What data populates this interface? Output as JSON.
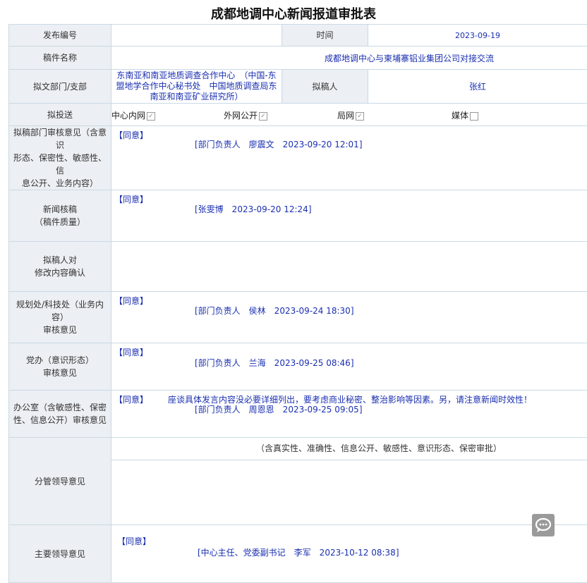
{
  "title": "成都地调中心新闻报道审批表",
  "labels": {
    "number": "发布编号",
    "time": "时间",
    "manuscript_name": "稿件名称",
    "department": "拟文部门/支部",
    "drafter": "拟稿人",
    "send_to": "拟投送",
    "dept_review_l1": "拟稿部门审核意见（含意识",
    "dept_review_l2": "形态、保密性、敏感性、信",
    "dept_review_l3": "息公开、业务内容）",
    "news_check_l1": "新闻核稿",
    "news_check_l2": "（稿件质量）",
    "drafter_confirm_l1": "拟稿人对",
    "drafter_confirm_l2": "修改内容确认",
    "planning_l1": "规划处/科技处（业务内",
    "planning_l2": "容）",
    "planning_l3": "审核意见",
    "party_l1": "党办（意识形态）",
    "party_l2": "审核意见",
    "office_l1": "办公室（含敏感性、保密",
    "office_l2": "性、信息公开）审核意见",
    "branch_leader": "分管领导意见",
    "main_leader": "主要领导意见"
  },
  "values": {
    "number": "",
    "time": "2023-09-19",
    "manuscript_name": "成都地调中心与柬埔寨铝业集团公司对接交流",
    "department_l1": "东南亚和南亚地质调查合作中心　（中国-东",
    "department_l2": "盟地学合作中心秘书处　中国地质调查局东",
    "department_l3": "南亚和南亚矿业研究所）",
    "drafter": "张红"
  },
  "send_options": [
    {
      "label": "中心内网",
      "checked": true
    },
    {
      "label": "外网公开",
      "checked": true
    },
    {
      "label": "局网",
      "checked": true
    },
    {
      "label": "媒体",
      "checked": false
    }
  ],
  "check_mark": "✓",
  "opinions": {
    "dept_review": {
      "agree": "【同意】",
      "sign": "[部门负责人　廖震文　2023-09-20 12:01]"
    },
    "news_check": {
      "agree": "【同意】",
      "sign": "[张雯博　2023-09-20 12:24]"
    },
    "planning": {
      "agree": "【同意】",
      "sign": "[部门负责人　侯林　2023-09-24 18:30]"
    },
    "party": {
      "agree": "【同意】",
      "sign": "[部门负责人　兰海　2023-09-25 08:46]"
    },
    "office": {
      "agree": "【同意】",
      "comment": "座谈具体发言内容没必要详细列出，要考虑商业秘密、整治影响等因素。另，请注意新闻时效性！",
      "sign": "[部门负责人　周恩恩　2023-09-25 09:05]"
    },
    "branch_leader": {
      "note": "（含真实性、准确性、信息公开、敏感性、意识形态、保密审批）"
    },
    "main_leader": {
      "agree": "【同意】",
      "sign": "[中心主任、党委副书记　李军　2023-10-12 08:38]"
    }
  },
  "colors": {
    "label_bg": "#eceff3",
    "border": "#c9d9e6",
    "value_text": "#1a2fb0"
  },
  "icons": {
    "feedback": "chat-bubble-icon"
  }
}
